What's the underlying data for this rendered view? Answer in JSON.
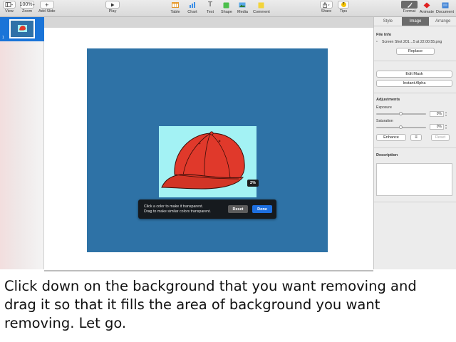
{
  "toolbar": {
    "view_label": "View",
    "zoom_value": "100%",
    "zoom_label": "Zoom",
    "add_slide_label": "Add Slide",
    "play_label": "Play",
    "table_label": "Table",
    "chart_label": "Chart",
    "text_label": "Text",
    "shape_label": "Shape",
    "media_label": "Media",
    "comment_label": "Comment",
    "share_label": "Share",
    "tips_label": "Tips",
    "format_label": "Format",
    "animate_label": "Animate",
    "document_label": "Document"
  },
  "navigator": {
    "slide_number": "1"
  },
  "canvas": {
    "percent_badge": "2%",
    "popup": {
      "line1": "Click a color to make it transparent.",
      "line2": "Drag to make similar colors transparent.",
      "reset_label": "Reset",
      "done_label": "Done"
    }
  },
  "inspector": {
    "tabs": [
      "Style",
      "Image",
      "Arrange"
    ],
    "active_tab": "Image",
    "file_info_heading": "File Info",
    "file_name": "Screen Shot 201…5 at 22.00.55.png",
    "replace_label": "Replace",
    "edit_mask_label": "Edit Mask",
    "instant_alpha_label": "Instant Alpha",
    "adjustments_heading": "Adjustments",
    "exposure_label": "Exposure",
    "exposure_value": "0%",
    "saturation_label": "Saturation",
    "saturation_value": "0%",
    "enhance_label": "Enhance",
    "reset_label": "Reset",
    "description_heading": "Description"
  },
  "caption": {
    "text": "Click down on the background that you want removing and drag it so that it fills the area of background you want removing. Let go."
  },
  "colors": {
    "slide_background": "#2e72a6",
    "image_background": "#a3f2f4",
    "cap_red": "#e0392b",
    "selection_blue": "#1a74d8",
    "done_button": "#1d6fe0"
  }
}
